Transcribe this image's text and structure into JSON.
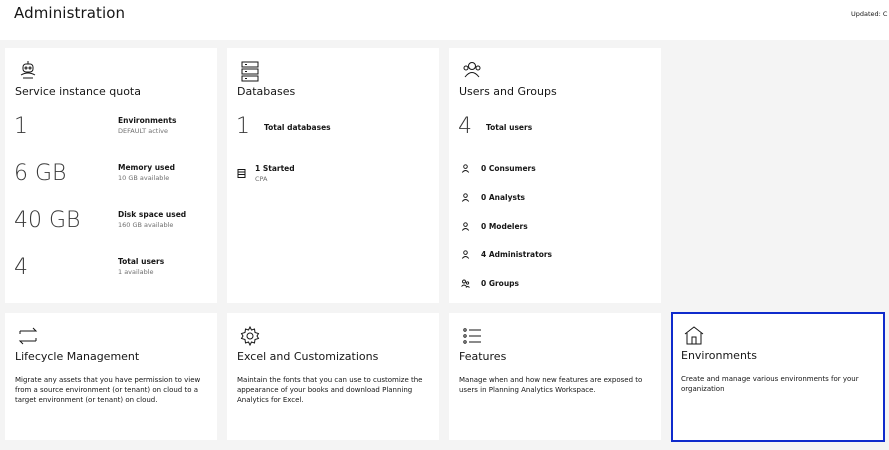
{
  "header": {
    "title": "Administration",
    "updated_label": "Updated: C"
  },
  "tiles": {
    "service_quota": {
      "title": "Service instance quota",
      "icon": "robot-icon",
      "stats": [
        {
          "value": "1",
          "label": "Environments",
          "sub": "DEFAULT active"
        },
        {
          "value": "6 GB",
          "label": "Memory used",
          "sub": "10 GB available"
        },
        {
          "value": "40 GB",
          "label": "Disk space used",
          "sub": "160 GB available"
        },
        {
          "value": "4",
          "label": "Total users",
          "sub": "1 available"
        }
      ]
    },
    "databases": {
      "title": "Databases",
      "icon": "database-icon",
      "total_value": "1",
      "total_label": "Total databases",
      "started_label": "1 Started",
      "started_sub": "CPA"
    },
    "users_groups": {
      "title": "Users and Groups",
      "icon": "users-icon",
      "total_value": "4",
      "total_label": "Total users",
      "rows": [
        {
          "label": "0 Consumers"
        },
        {
          "label": "0 Analysts"
        },
        {
          "label": "0 Modelers"
        },
        {
          "label": "4 Administrators"
        },
        {
          "label": "0 Groups"
        }
      ]
    },
    "lifecycle": {
      "title": "Lifecycle Management",
      "icon": "swap-arrows-icon",
      "description": "Migrate any assets that you have permission to view from a source environment (or tenant) on cloud to a target environment (or tenant) on cloud."
    },
    "excel": {
      "title": "Excel and Customizations",
      "icon": "settings-cog-icon",
      "description": "Maintain the fonts that you can use to customize the appearance of your books and download Planning Analytics for Excel."
    },
    "features": {
      "title": "Features",
      "icon": "list-bullets-icon",
      "description": "Manage when and how new features are exposed to users in Planning Analytics Workspace."
    },
    "environments": {
      "title": "Environments",
      "icon": "home-icon",
      "description": "Create and manage various environments for your organization"
    }
  },
  "colors": {
    "selected_border": "#0f2bcc",
    "background": "#f4f4f4",
    "tile": "#ffffff"
  }
}
